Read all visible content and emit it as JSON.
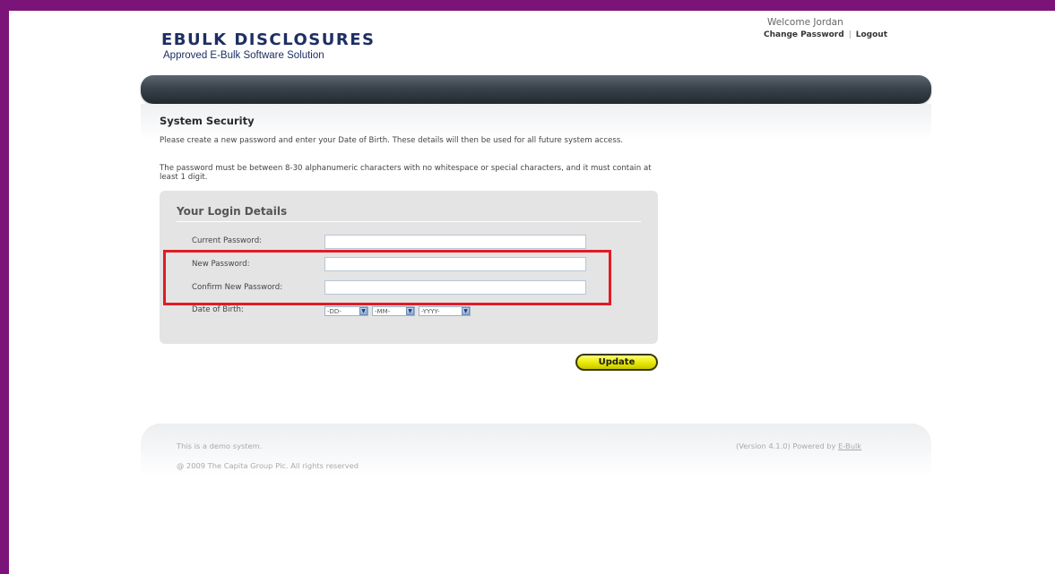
{
  "brand": {
    "title": "EBULK DISCLOSURES",
    "subtitle": "Approved E-Bulk Software Solution"
  },
  "header": {
    "welcome": "Welcome Jordan",
    "change_password": "Change Password",
    "separator": "|",
    "logout": "Logout"
  },
  "page": {
    "title": "System Security",
    "intro": "Please create a new password and enter your Date of Birth. These details will then be used for all future system access.",
    "rules": "The password must be between 8-30 alphanumeric characters with no whitespace or special characters, and it must contain at least 1 digit."
  },
  "login_box": {
    "title": "Your Login Details",
    "current_password_label": "Current Password:",
    "current_password_value": "",
    "new_password_label": "New Password:",
    "new_password_value": "",
    "confirm_password_label": "Confirm New Password:",
    "confirm_password_value": "",
    "dob_label": "Date of Birth:",
    "dob_day": "-DD-",
    "dob_month": "-MM-",
    "dob_year": "-YYYY-"
  },
  "actions": {
    "update": "Update"
  },
  "footer": {
    "demo": "This is a demo system.",
    "copyright": "@ 2009 The Capita Group Plc. All rights reserved",
    "version_text": "(Version 4.1.0) Powered by",
    "version_link": "E-Bulk"
  },
  "colors": {
    "frame": "#7b1479",
    "brand": "#1d2f63",
    "highlight": "#e01c24",
    "update_button": "#e8e800"
  }
}
